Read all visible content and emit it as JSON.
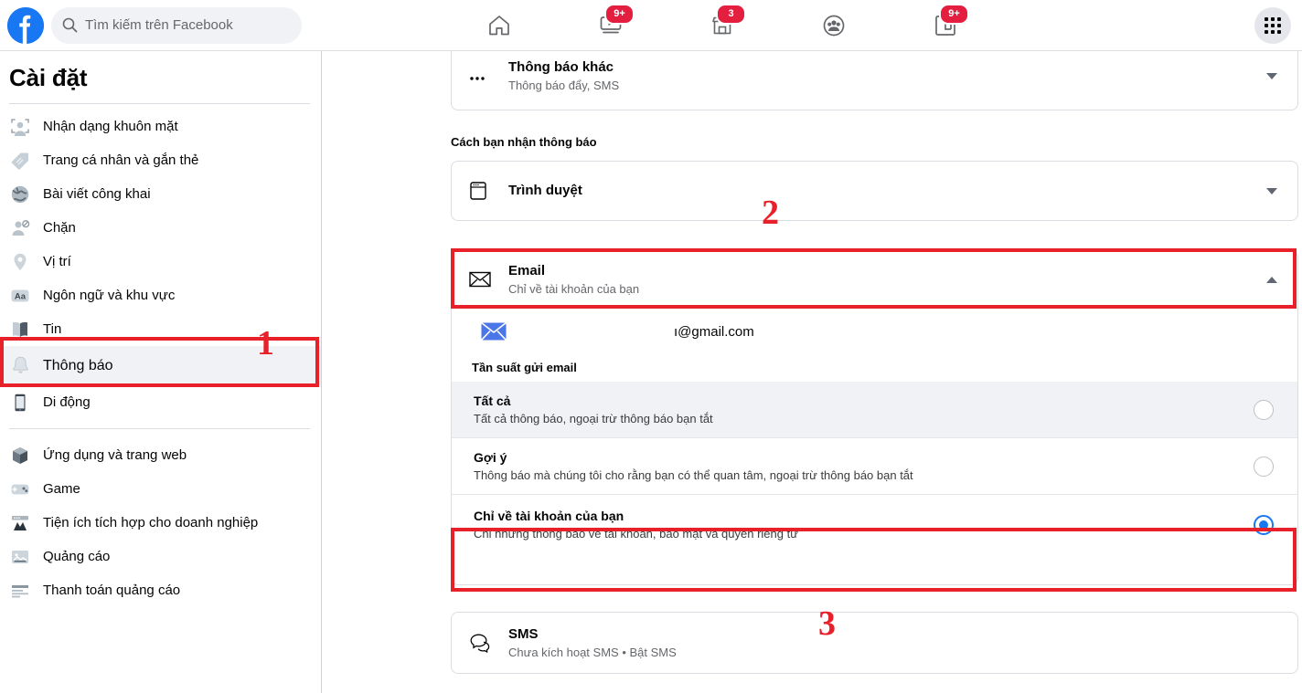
{
  "topbar": {
    "logo_icon": "facebook-logo-icon",
    "search": {
      "placeholder": "Tìm kiếm trên Facebook",
      "value": "",
      "icon": "search-icon"
    },
    "nav": [
      {
        "name": "home",
        "icon": "home-icon",
        "badge": ""
      },
      {
        "name": "video",
        "icon": "video-play-icon",
        "badge": "9+"
      },
      {
        "name": "marketplace",
        "icon": "marketplace-store-icon",
        "badge": "3"
      },
      {
        "name": "groups",
        "icon": "groups-people-icon",
        "badge": ""
      },
      {
        "name": "gaming",
        "icon": "gaming-controller-icon",
        "badge": "9+"
      }
    ],
    "menu_icon": "grid-menu-icon"
  },
  "sidebar": {
    "title": "Cài đặt",
    "items": [
      {
        "label": "Nhận dạng khuôn mặt",
        "icon": "face-recognition-icon",
        "active": false
      },
      {
        "label": "Trang cá nhân và gắn thẻ",
        "icon": "tag-icon",
        "active": false
      },
      {
        "label": "Bài viết công khai",
        "icon": "globe-icon",
        "active": false
      },
      {
        "label": "Chặn",
        "icon": "block-user-icon",
        "active": false
      },
      {
        "label": "Vị trí",
        "icon": "location-pin-icon",
        "active": false
      },
      {
        "label": "Ngôn ngữ và khu vực",
        "icon": "language-aa-icon",
        "active": false
      },
      {
        "label": "Tin",
        "icon": "stories-book-icon",
        "active": false
      },
      {
        "label": "Thông báo",
        "icon": "bell-icon",
        "active": true
      },
      {
        "label": "Di động",
        "icon": "mobile-phone-icon",
        "active": false
      }
    ],
    "items_group2": [
      {
        "label": "Ứng dụng và trang web",
        "icon": "apps-cube-icon",
        "active": false
      },
      {
        "label": "Game",
        "icon": "game-controller-icon",
        "active": false
      },
      {
        "label": "Tiện ích tích hợp cho doanh nghiệp",
        "icon": "business-integration-icon",
        "active": false
      },
      {
        "label": "Quảng cáo",
        "icon": "ads-image-icon",
        "active": false
      },
      {
        "label": "Thanh toán quảng cáo",
        "icon": "ad-payment-card-icon",
        "active": false
      }
    ]
  },
  "main": {
    "other_notifications": {
      "title": "Thông báo khác",
      "subtitle": "Thông báo đẩy, SMS",
      "icon": "more-dots-icon",
      "chevron": "chevron-down-icon"
    },
    "section_label": "Cách bạn nhận thông báo",
    "browser": {
      "title": "Trình duyệt",
      "subtitle": "",
      "icon": "browser-window-icon",
      "chevron": "chevron-down-icon"
    },
    "email": {
      "title": "Email",
      "subtitle": "Chỉ về tài khoản của bạn",
      "icon": "envelope-outline-icon",
      "chevron": "chevron-up-icon",
      "address": "ı@gmail.com",
      "address_icon": "envelope-blue-icon",
      "frequency_label": "Tần suất gửi email",
      "options": [
        {
          "title": "Tất cả",
          "subtitle": "Tất cả thông báo, ngoại trừ thông báo bạn tắt",
          "selected": false,
          "highlighted_bg": true
        },
        {
          "title": "Gợi ý",
          "subtitle": "Thông báo mà chúng tôi cho rằng bạn có thể quan tâm, ngoại trừ thông báo bạn tắt",
          "selected": false,
          "highlighted_bg": false
        },
        {
          "title": "Chỉ về tài khoản của bạn",
          "subtitle": "Chỉ những thông báo về tài khoản, bảo mật và quyền riêng tư",
          "selected": true,
          "highlighted_bg": false
        }
      ]
    },
    "sms": {
      "title": "SMS",
      "subtitle": "Chưa kích hoạt SMS • Bật SMS",
      "icon": "chat-bubbles-icon",
      "chevron": ""
    }
  },
  "annotations": {
    "markers": [
      {
        "label": "1",
        "name": "marker-1"
      },
      {
        "label": "2",
        "name": "marker-2"
      },
      {
        "label": "3",
        "name": "marker-3"
      }
    ],
    "highlight_color": "#e8202a"
  },
  "colors": {
    "brand_blue": "#1877f2",
    "badge_red": "#e41e3f",
    "annotation_red": "#e8202a",
    "surface_gray": "#f0f2f5",
    "text_secondary": "#65676b"
  }
}
